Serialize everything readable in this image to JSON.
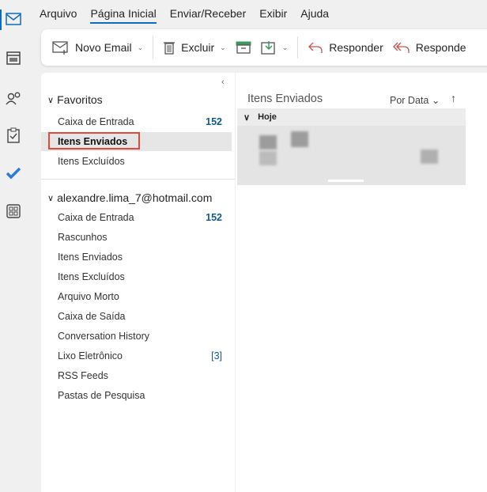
{
  "rail": {
    "icons": [
      "mail-icon",
      "calendar-icon",
      "people-icon",
      "tasks-icon",
      "todo-check-icon",
      "apps-icon"
    ]
  },
  "menu": {
    "tabs": [
      "Arquivo",
      "Página Inicial",
      "Enviar/Receber",
      "Exibir",
      "Ajuda"
    ],
    "selected": "Página Inicial"
  },
  "toolbar": {
    "new_email": "Novo Email",
    "delete": "Excluir",
    "reply": "Responder",
    "reply_all": "Responde"
  },
  "colors": {
    "accent": "#0f6cbd",
    "highlight_box": "#e04a3a"
  },
  "favorites": {
    "title": "Favoritos",
    "items": [
      {
        "label": "Caixa de Entrada",
        "count": "152"
      },
      {
        "label": "Itens Enviados",
        "selected": true
      },
      {
        "label": "Itens Excluídos"
      }
    ]
  },
  "account": {
    "title": "alexandre.lima_7@hotmail.com",
    "items": [
      {
        "label": "Caixa de Entrada",
        "count": "152"
      },
      {
        "label": "Rascunhos"
      },
      {
        "label": "Itens Enviados"
      },
      {
        "label": "Itens Excluídos"
      },
      {
        "label": "Arquivo Morto"
      },
      {
        "label": "Caixa de Saída"
      },
      {
        "label": "Conversation History"
      },
      {
        "label": "Lixo Eletrônico",
        "count": "[3]"
      },
      {
        "label": "RSS Feeds"
      },
      {
        "label": "Pastas de Pesquisa"
      }
    ]
  },
  "message_list": {
    "title": "Itens Enviados",
    "sort": "Por Data",
    "group": "Hoje"
  }
}
